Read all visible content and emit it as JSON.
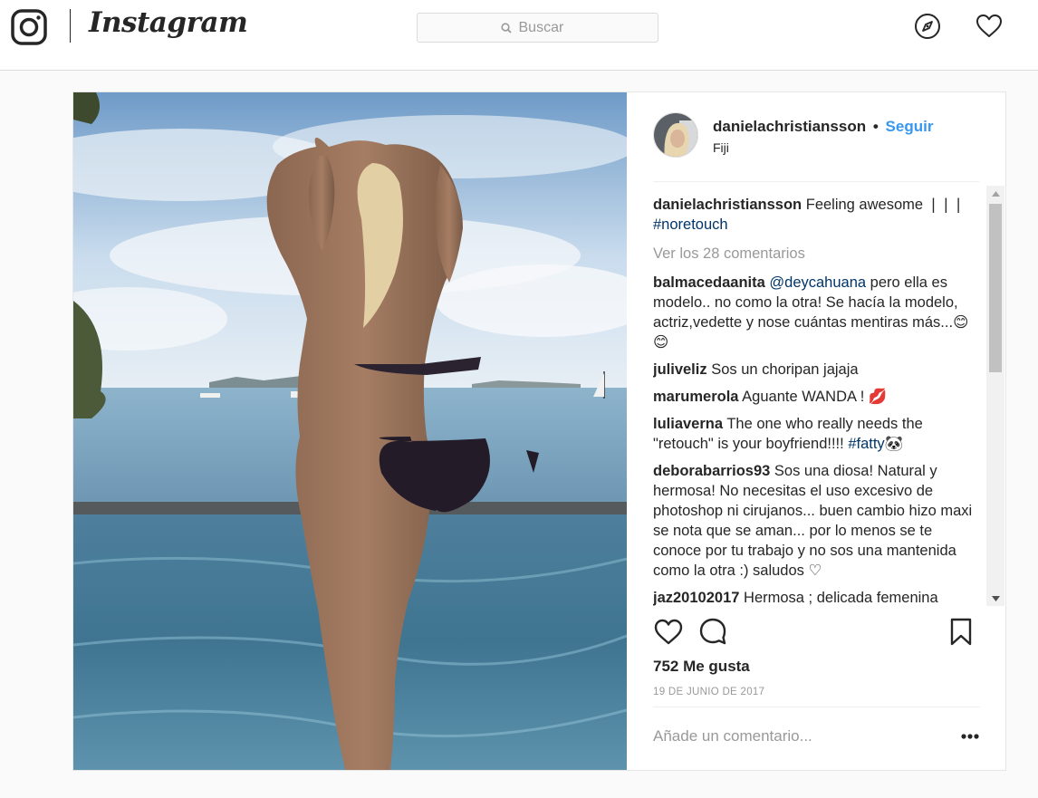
{
  "header": {
    "wordmark": "Instagram",
    "search_placeholder": "Buscar",
    "icons": [
      "instagram-glyph-icon",
      "search-icon",
      "compass-icon",
      "heart-icon"
    ]
  },
  "post": {
    "username": "danielachristiansson",
    "separator": "•",
    "follow_label": "Seguir",
    "location": "Fiji",
    "caption": {
      "username": "danielachristiansson",
      "text": "Feeling awesome ❘❘❘",
      "hashtag": "#noretouch"
    },
    "view_all_comments": "Ver los 28 comentarios",
    "comments": [
      {
        "user": "balmacedaanita",
        "mention": "@deycahuana",
        "text": " pero ella es modelo.. no como la otra! Se hacía la modelo, actriz,vedette y nose cuántas mentiras más...😊😊"
      },
      {
        "user": "juliveliz",
        "text": "Sos un choripan jajaja"
      },
      {
        "user": "marumerola",
        "text": "Aguante WANDA ! 💋"
      },
      {
        "user": "luliaverna",
        "text": "The one who really needs the \"retouch\" is your boyfriend!!!! ",
        "hashtag": "#fatty",
        "emoji": "🐼"
      },
      {
        "user": "deborabarrios93",
        "text": "Sos una diosa! Natural y hermosa! No necesitas el uso excesivo de photoshop ni cirujanos... buen cambio hizo maxi se nota que se aman... por lo menos se te conoce por tu trabajo y no sos una mantenida como la otra :) saludos ♡"
      },
      {
        "user": "jaz20102017",
        "text": "Hermosa ; delicada femenina"
      }
    ],
    "likes": "752 Me gusta",
    "date": "19 DE JUNIO DE 2017",
    "add_comment_placeholder": "Añade un comentario..."
  },
  "colors": {
    "link_blue": "#3897f0",
    "hashtag_blue": "#003569",
    "text": "#262626",
    "muted": "#999999",
    "border": "#dbdbdb"
  }
}
